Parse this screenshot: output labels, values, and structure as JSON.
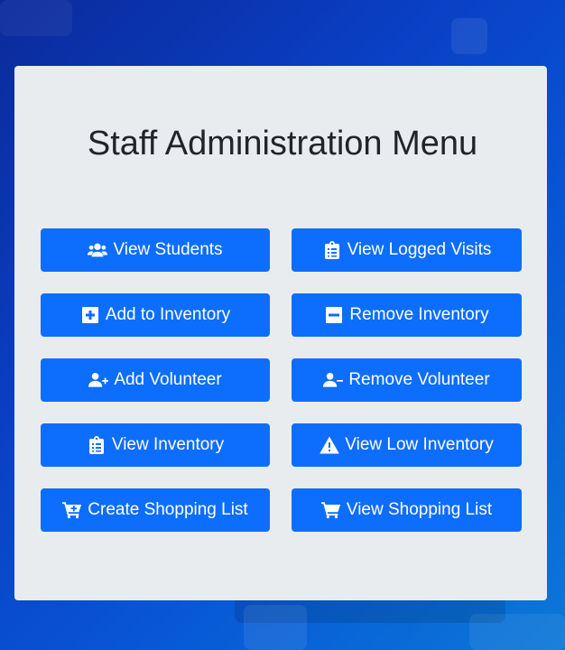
{
  "page": {
    "title": "Staff Administration Menu"
  },
  "buttons": {
    "view_students": "View Students",
    "view_logged_visits": "View Logged Visits",
    "add_to_inventory": "Add to Inventory",
    "remove_inventory": "Remove Inventory",
    "add_volunteer": "Add Volunteer",
    "remove_volunteer": "Remove Volunteer",
    "view_inventory": "View Inventory",
    "view_low_inventory": "View Low Inventory",
    "create_shopping_list": "Create Shopping List",
    "view_shopping_list": "View Shopping List"
  },
  "icons": {
    "view_students": "users-icon",
    "view_logged_visits": "clipboard-list-icon",
    "add_to_inventory": "plus-square-icon",
    "remove_inventory": "minus-square-icon",
    "add_volunteer": "user-plus-icon",
    "remove_volunteer": "user-minus-icon",
    "view_inventory": "clipboard-list-icon",
    "view_low_inventory": "warning-triangle-icon",
    "create_shopping_list": "cart-plus-icon",
    "view_shopping_list": "cart-icon"
  },
  "colors": {
    "button_bg": "#0d6efd",
    "panel_bg": "#e9ecef",
    "title_text": "#212529"
  }
}
